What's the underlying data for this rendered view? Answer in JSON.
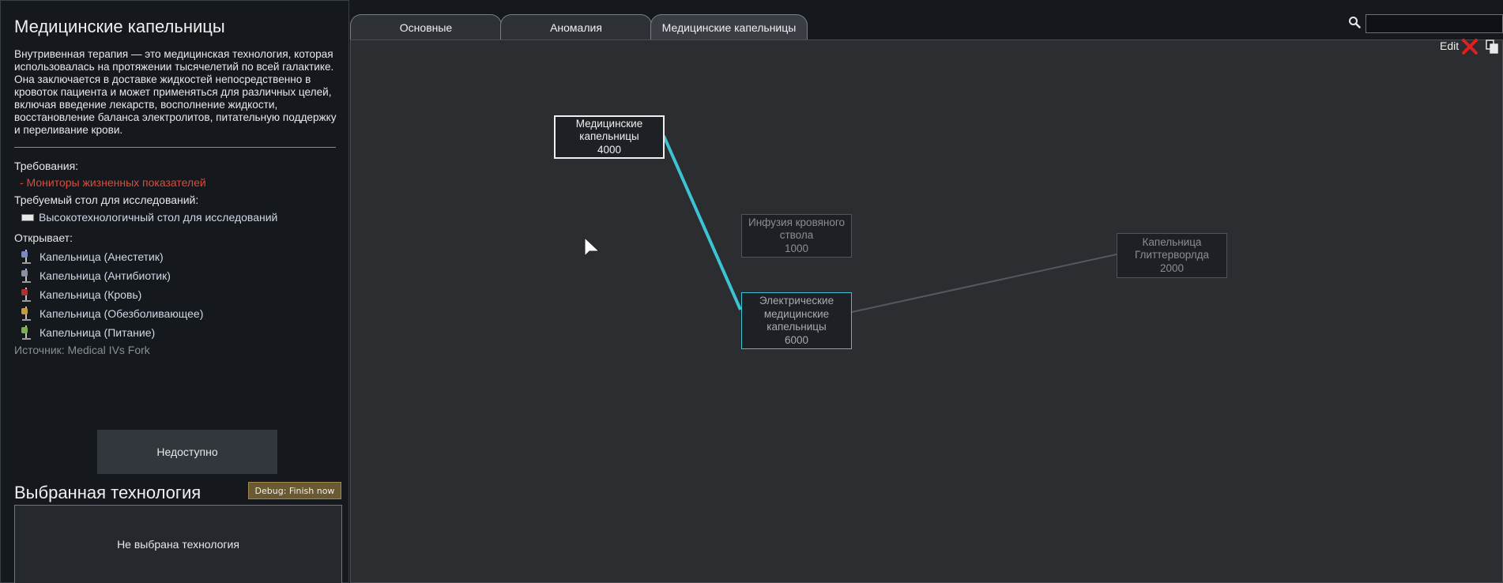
{
  "left": {
    "title": "Медицинские капельницы",
    "description": "Внутривенная терапия — это медицинская технология, которая использовалась на протяжении тысячелетий по всей галактике. Она заключается в доставке жидкостей непосредственно в кровоток пациента и может применяться для различных целей, включая введение лекарств, восполнение жидкости, восстановление баланса электролитов, питательную поддержку и переливание крови.",
    "requirements_label": "Требования:",
    "requirement": " - Мониторы жизненных показателей",
    "bench_label": "Требуемый стол для исследований:",
    "bench": "Высокотехнологичный стол для исследований",
    "unlocks_label": "Открывает:",
    "unlocks": [
      {
        "label": "Капельница (Анестетик)",
        "color": "#7a88c8"
      },
      {
        "label": "Капельница (Антибиотик)",
        "color": "#8a8fa8"
      },
      {
        "label": "Капельница (Кровь)",
        "color": "#b03030"
      },
      {
        "label": "Капельница (Обезболивающее)",
        "color": "#c89a40"
      },
      {
        "label": "Капельница (Питание)",
        "color": "#7ab050"
      }
    ],
    "source": "Источник:  Medical IVs Fork",
    "unavailable": "Недоступно",
    "selected_title": "Выбранная технология",
    "debug": "Debug: Finish now",
    "no_selection": "Не выбрана технология"
  },
  "tabs": [
    {
      "label": "Основные"
    },
    {
      "label": "Аномалия"
    },
    {
      "label": "Медицинские капельницы",
      "active": true
    }
  ],
  "search": {
    "value": ""
  },
  "edit_label": "Edit",
  "nodes": [
    {
      "name": "Медицинские капельницы",
      "cost": "4000",
      "state": "selected"
    },
    {
      "name": "Инфузия кровяного ствола",
      "cost": "1000",
      "state": "locked"
    },
    {
      "name": "Электрические медицинские капельницы",
      "cost": "6000",
      "state": "available"
    },
    {
      "name": "Капельница Глиттерворлда",
      "cost": "2000",
      "state": "locked"
    }
  ],
  "colors": {
    "accent": "#3cc4d4",
    "requirement_missing": "#e04a3a",
    "close_red": "#e02020"
  }
}
